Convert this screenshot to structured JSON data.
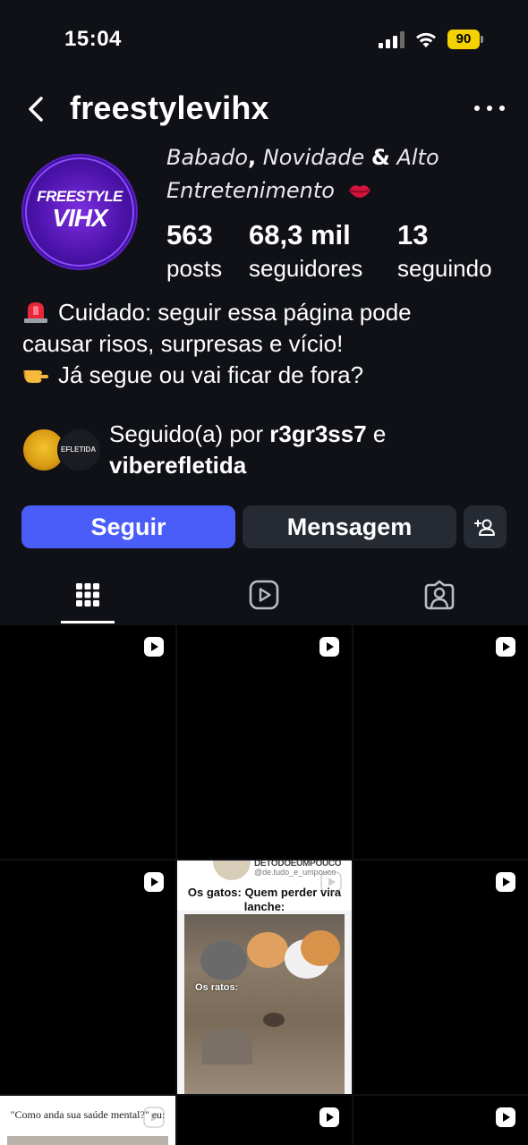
{
  "status_bar": {
    "time": "15:04",
    "battery": "90",
    "battery_color": "#f3d200",
    "icons": [
      "signal-icon",
      "wifi-icon",
      "battery-icon"
    ]
  },
  "header": {
    "back_icon": "chevron-left-icon",
    "username": "freestylevihx",
    "more_icon": "more-horizontal-icon"
  },
  "profile": {
    "avatar_line1": "FREESTYLE",
    "avatar_line2": "VIHX",
    "category_line1_a": "Babado",
    "category_line1_b": ",",
    "category_line1_c": " Novidade ",
    "category_line1_d": "&",
    "category_line1_e": " Alto",
    "category_line2": "Entretenimento",
    "stats": [
      {
        "value": "563",
        "label": "posts"
      },
      {
        "value": "68,3 mil",
        "label": "seguidores"
      },
      {
        "value": "13",
        "label": "seguindo"
      }
    ]
  },
  "bio": {
    "line1": "Cuidado: seguir essa página pode",
    "line2": "causar risos, surpresas e vício!",
    "line3": "Já segue ou vai ficar de fora?",
    "line1_icon": "siren-icon",
    "line3_icon": "pointing-hand-icon"
  },
  "followed_by": {
    "prefix": "Seguido(a) por ",
    "user1": "r3gr3ss7",
    "joiner": " e",
    "user2": "viberefletida",
    "avatar2_text": "EFLETIDA"
  },
  "actions": {
    "follow": "Seguir",
    "message": "Mensagem",
    "add_icon": "add-person-icon",
    "follow_color": "#4a5df9"
  },
  "tabs": [
    {
      "name": "grid",
      "icon": "grid-icon",
      "active": true
    },
    {
      "name": "reels",
      "icon": "reels-icon",
      "active": false
    },
    {
      "name": "tagged",
      "icon": "tagged-person-icon",
      "active": false
    }
  ],
  "grid": {
    "meme1": {
      "header_name": "DETODOEUMPOUCO",
      "header_handle": "@de.tudo_e_umpouco",
      "caption_top": "Os gatos: Quem perder vira lanche:",
      "caption_mid": "Os ratos:"
    },
    "meme2": {
      "caption": "\"Como anda sua saúde mental?\" eu:"
    }
  }
}
